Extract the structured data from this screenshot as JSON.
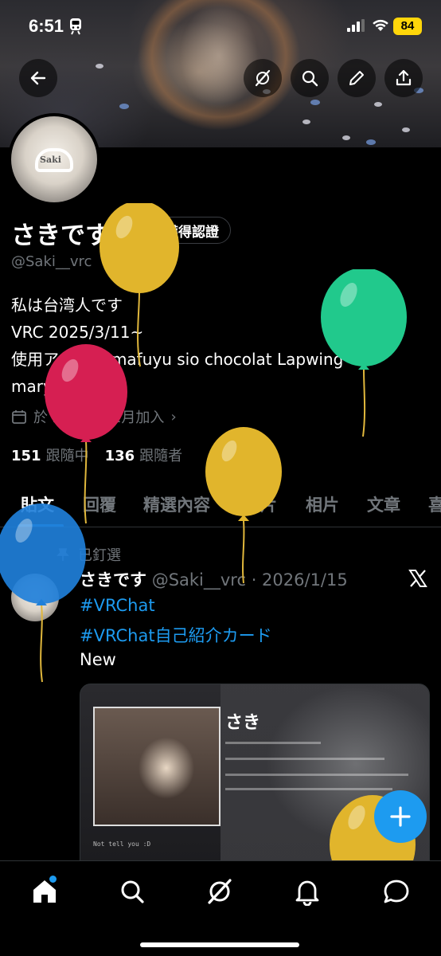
{
  "status_bar": {
    "time": "6:51",
    "battery": "84"
  },
  "profile": {
    "display_name": "さきです",
    "verified_label": "獲得認證",
    "handle": "@Saki__vrc",
    "avatar_text": "Saki",
    "bio": [
      "私は台湾人です",
      "VRC 2025/3/11~",
      "使用アバター:mafuyu sio chocolat Lapwing",
      "marycia"
    ],
    "joined": "於 2021年12月加入",
    "following_count": "151",
    "following_label": "跟隨中",
    "followers_count": "136",
    "followers_label": "跟隨者"
  },
  "tabs": [
    "貼文",
    "回覆",
    "精選內容",
    "影片",
    "相片",
    "文章",
    "喜"
  ],
  "post": {
    "pinned_label": "已釘選",
    "author_name": "さきです",
    "author_meta": "@Saki__vrc · 2026/1/15",
    "lines": [
      "#VRChat",
      "#VRChat自己紹介カード",
      "New"
    ],
    "card_title": "さき",
    "card_caption": "Not tell you :D"
  },
  "icons": {
    "back": "arrow-left-icon",
    "grok": "grok-icon",
    "search": "search-icon",
    "edit": "pencil-icon",
    "share": "share-icon",
    "calendar": "calendar-icon",
    "pin": "pin-icon",
    "x_logo": "x-logo-icon",
    "compose": "plus-icon",
    "nav": [
      "home-icon",
      "search-icon",
      "grok-icon",
      "bell-icon",
      "message-icon"
    ]
  },
  "colors": {
    "accent": "#1d9bf0",
    "background": "#000000",
    "muted": "#71767b",
    "battery": "#ffd60a"
  },
  "balloons": [
    "yellow",
    "green",
    "red",
    "yellow",
    "blue",
    "yellow"
  ]
}
